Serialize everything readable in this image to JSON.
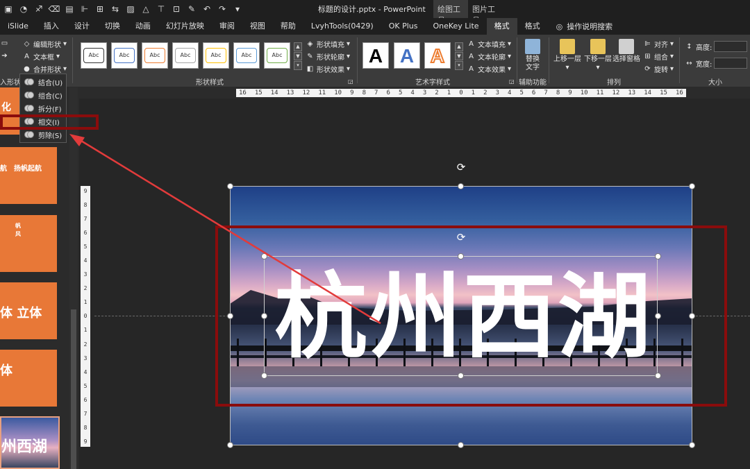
{
  "window": {
    "doc_title": "标题的设计.pptx  -  PowerPoint",
    "context_tabs": [
      "绘图工具",
      "图片工具"
    ]
  },
  "tabs": [
    {
      "label": "iSlide"
    },
    {
      "label": "插入"
    },
    {
      "label": "设计"
    },
    {
      "label": "切换"
    },
    {
      "label": "动画"
    },
    {
      "label": "幻灯片放映"
    },
    {
      "label": "审阅"
    },
    {
      "label": "视图"
    },
    {
      "label": "帮助"
    },
    {
      "label": "LvyhTools(0429)"
    },
    {
      "label": "OK Plus"
    },
    {
      "label": "OneKey Lite"
    },
    {
      "label": "格式",
      "active": true
    },
    {
      "label": "格式"
    }
  ],
  "tell_me": "操作说明搜索",
  "ribbon": {
    "insert_shapes": {
      "edit_shape": "编辑形状",
      "text_box": "文本框",
      "merge_shapes": "合并形状",
      "label_partial": "入形状"
    },
    "shape_styles": {
      "label": "形状样式",
      "thumb_text": "Abc",
      "fill": "形状填充",
      "outline": "形状轮廓",
      "effects": "形状效果",
      "thumb_colors": [
        "#333333",
        "#4472c4",
        "#ed7d31",
        "#a5a5a5",
        "#ffc000",
        "#5b9bd5",
        "#70ad47"
      ]
    },
    "wordart": {
      "label": "艺术字样式",
      "glyph": "A",
      "fill": "文本填充",
      "outline": "文本轮廓",
      "effects": "文本效果"
    },
    "accessibility": {
      "label": "辅助功能",
      "alt_text": "替换\n文字"
    },
    "arrange": {
      "label": "排列",
      "bring_forward": "上移一层",
      "send_backward": "下移一层",
      "selection_pane": "选择窗格",
      "align": "对齐",
      "group": "组合",
      "rotate": "旋转"
    },
    "size": {
      "label": "大小",
      "height": "高度:",
      "width": "宽度:"
    }
  },
  "merge_menu": [
    {
      "label": "结合(U)",
      "name": "union"
    },
    {
      "label": "组合(C)",
      "name": "combine"
    },
    {
      "label": "拆分(F)",
      "name": "fragment"
    },
    {
      "label": "相交(I)",
      "name": "intersect"
    },
    {
      "label": "剪除(S)",
      "name": "subtract"
    }
  ],
  "ruler": {
    "h_ticks": [
      "16",
      "15",
      "14",
      "13",
      "12",
      "11",
      "10",
      "9",
      "8",
      "7",
      "6",
      "5",
      "4",
      "3",
      "2",
      "1",
      "0",
      "1",
      "2",
      "3",
      "4",
      "5",
      "6",
      "7",
      "8",
      "9",
      "10",
      "11",
      "12",
      "13",
      "14",
      "15",
      "16"
    ],
    "v_ticks": [
      "9",
      "8",
      "7",
      "6",
      "5",
      "4",
      "3",
      "2",
      "1",
      "0",
      "1",
      "2",
      "3",
      "4",
      "5",
      "6",
      "7",
      "8",
      "9"
    ]
  },
  "slides": [
    {
      "text": "化"
    },
    {
      "text": "扬帆起航",
      "text2": "航"
    },
    {
      "text": "帆\n风"
    },
    {
      "text": "体 立体"
    },
    {
      "text": "体"
    },
    {
      "text": "州西湖"
    }
  ],
  "slide": {
    "title": "杭州西湖"
  },
  "colors": {
    "annotation": "#8a0c0c",
    "arrow": "#e23b3b",
    "thumb_bg": "#e87837"
  }
}
